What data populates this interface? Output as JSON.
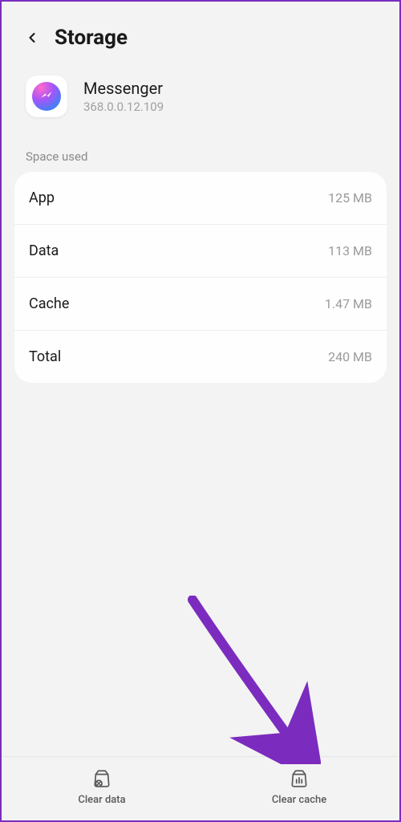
{
  "header": {
    "title": "Storage"
  },
  "app": {
    "name": "Messenger",
    "version": "368.0.0.12.109"
  },
  "section": {
    "space_used": "Space used"
  },
  "rows": {
    "app": {
      "label": "App",
      "value": "125 MB"
    },
    "data": {
      "label": "Data",
      "value": "113 MB"
    },
    "cache": {
      "label": "Cache",
      "value": "1.47 MB"
    },
    "total": {
      "label": "Total",
      "value": "240 MB"
    }
  },
  "bottom": {
    "clear_data": "Clear data",
    "clear_cache": "Clear cache"
  }
}
